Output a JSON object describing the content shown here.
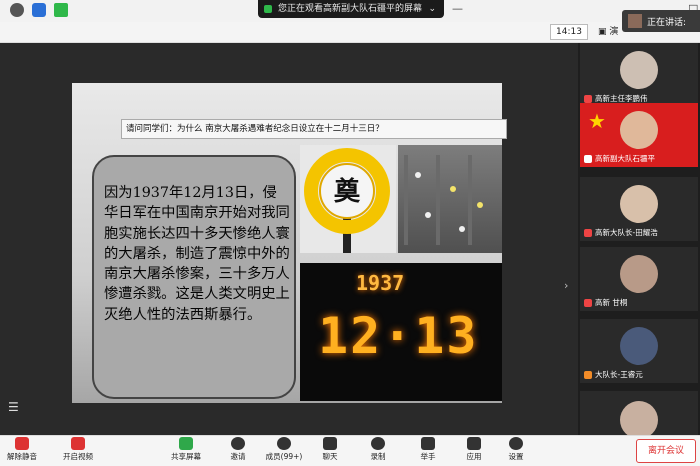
{
  "share_banner": {
    "text": "您正在观看高新副大队石疆平的屏幕",
    "chevron": "⌄"
  },
  "window_controls": {
    "minimize": "—",
    "maximize": "□"
  },
  "infobar": {
    "timer": "14:13",
    "view_label": "演",
    "icons": [
      "info-icon",
      "shield-icon",
      "signal-icon"
    ]
  },
  "speaking": {
    "label": "正在讲话:"
  },
  "slide": {
    "question": "请问同学们：为什么 南京大屠杀遇难者纪念日设立在十二月十三日？",
    "callout_text": "因为1937年12月13日，侵华日军在中国南京开始对我同胞实施长达四十多天惨绝人寰的大屠杀，制造了震惊中外的南京大屠杀惨案，三十多万人惨遭杀戮。这是人类文明史上灭绝人性的法西斯暴行。",
    "wreath_char": "奠",
    "candles_big": "12·13",
    "candles_small": "1937"
  },
  "participants": [
    {
      "name": "高新主任李鹏伟"
    },
    {
      "name": "高新副大队石疆平"
    },
    {
      "name": "高新大队长-田耀浩"
    },
    {
      "name": "高新 甘桐"
    },
    {
      "name": "大队长-王睿元"
    }
  ],
  "toolbar": {
    "mute": "解除静音",
    "video": "开启视频",
    "share": "共享屏幕",
    "invite": "邀请",
    "members": "成员(99+)",
    "chat": "聊天",
    "record": "录制",
    "raise_hand": "举手",
    "apps": "应用",
    "settings": "设置",
    "leave": "离开会议"
  },
  "colors": {
    "accent_green": "#2fb84a",
    "leave_red": "#d33333",
    "flag_red": "#d81e1e"
  }
}
